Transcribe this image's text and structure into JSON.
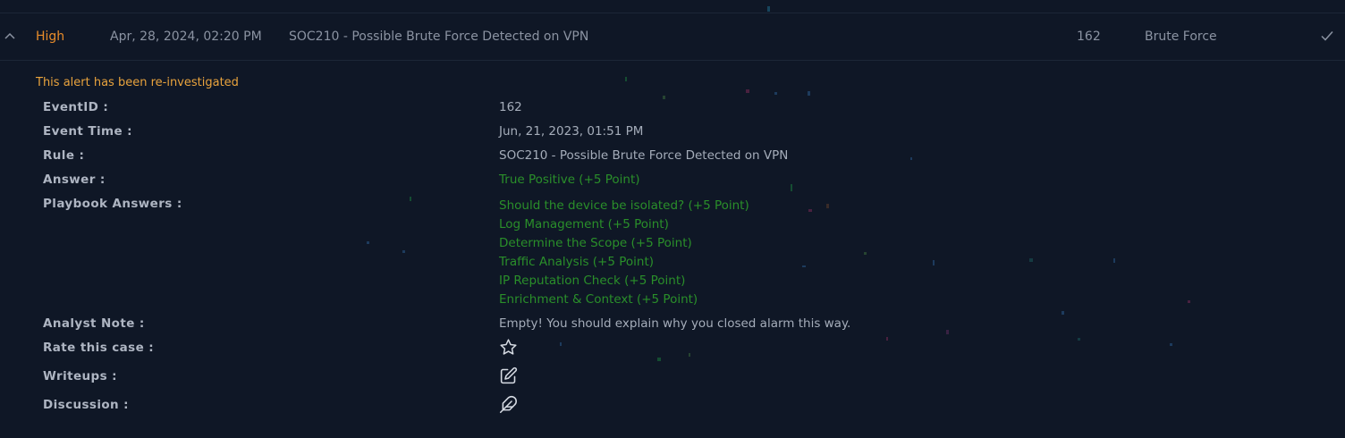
{
  "alert": {
    "severity": "High",
    "date": "Apr, 28, 2024, 02:20 PM",
    "rule": "SOC210 - Possible Brute Force Detected on VPN",
    "event_id": "162",
    "type": "Brute Force",
    "collapse_icon": "chevron-up-icon",
    "status_icon": "check-icon"
  },
  "details": {
    "reinvestigated_notice": "This alert has been re-investigated",
    "labels": {
      "event_id": "EventID :",
      "event_time": "Event Time :",
      "rule": "Rule :",
      "answer": "Answer :",
      "playbook_answers": "Playbook Answers :",
      "analyst_note": "Analyst Note :",
      "rate_case": "Rate this case :",
      "writeups": "Writeups :",
      "discussion": "Discussion :"
    },
    "values": {
      "event_id": "162",
      "event_time": "Jun, 21, 2023, 01:51 PM",
      "rule": "SOC210 - Possible Brute Force Detected on VPN",
      "answer": "True Positive (+5 Point)",
      "analyst_note": "Empty! You should explain why you closed alarm this way."
    },
    "playbook_answers": [
      "Should the device be isolated? (+5 Point)",
      "Log Management (+5 Point)",
      "Determine the Scope (+5 Point)",
      "Traffic Analysis (+5 Point)",
      "IP Reputation Check (+5 Point)",
      "Enrichment & Context (+5 Point)"
    ],
    "icons": {
      "rate": "star-icon",
      "writeups": "edit-icon",
      "discussion": "feather-icon"
    }
  },
  "colors": {
    "background": "#0f1726",
    "severity_high": "#e88c2a",
    "notice": "#e9a33d",
    "positive": "#2a8f2a",
    "label": "#aeb5c2",
    "value": "#a5adba",
    "muted": "#8b93a2"
  }
}
